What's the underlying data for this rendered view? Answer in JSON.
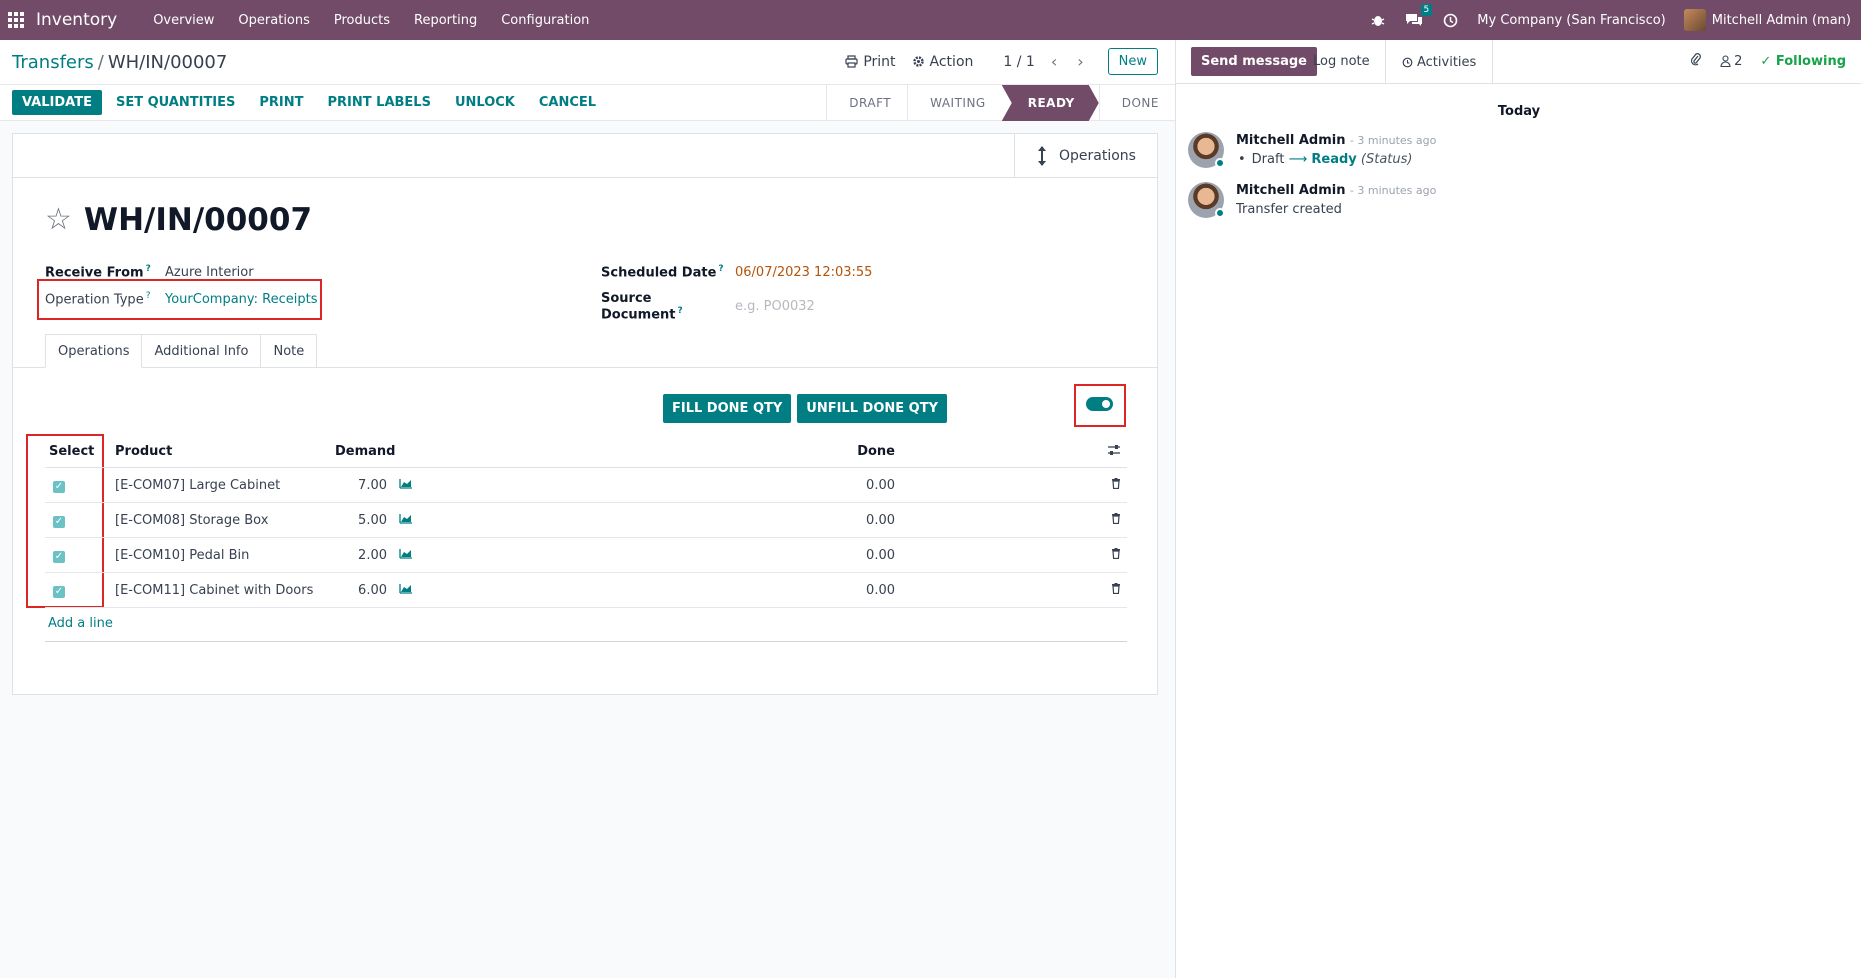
{
  "navbar": {
    "app_title": "Inventory",
    "menu": [
      "Overview",
      "Operations",
      "Products",
      "Reporting",
      "Configuration"
    ],
    "messages_count": "5",
    "company": "My Company (San Francisco)",
    "user": "Mitchell Admin (man)"
  },
  "control": {
    "breadcrumb_parent": "Transfers",
    "breadcrumb_sep": "/",
    "breadcrumb_current": "WH/IN/00007",
    "print_label": "Print",
    "action_label": "Action",
    "pager": "1 / 1",
    "new_label": "New"
  },
  "statusbar": {
    "buttons": [
      "VALIDATE",
      "SET QUANTITIES",
      "PRINT",
      "PRINT LABELS",
      "UNLOCK",
      "CANCEL"
    ],
    "stages": [
      "DRAFT",
      "WAITING",
      "READY",
      "DONE"
    ],
    "active_stage": "READY"
  },
  "form": {
    "smart_button": "Operations",
    "name": "WH/IN/00007",
    "receive_from_label": "Receive From",
    "receive_from_value": "Azure Interior",
    "operation_type_label": "Operation Type",
    "operation_type_value": "YourCompany: Receipts",
    "scheduled_date_label": "Scheduled Date",
    "scheduled_date_value": "06/07/2023 12:03:55",
    "source_document_label": "Source Document",
    "source_document_placeholder": "e.g. PO0032",
    "help_mark": "?",
    "tabs": [
      "Operations",
      "Additional Info",
      "Note"
    ],
    "fill_done": "FILL DONE QTY",
    "unfill_done": "UNFILL DONE QTY",
    "table": {
      "headers": {
        "select": "Select",
        "product": "Product",
        "demand": "Demand",
        "done": "Done"
      },
      "rows": [
        {
          "product": "[E-COM07] Large Cabinet",
          "demand": "7.00",
          "done": "0.00"
        },
        {
          "product": "[E-COM08] Storage Box",
          "demand": "5.00",
          "done": "0.00"
        },
        {
          "product": "[E-COM10] Pedal Bin",
          "demand": "2.00",
          "done": "0.00"
        },
        {
          "product": "[E-COM11] Cabinet with Doors",
          "demand": "6.00",
          "done": "0.00"
        }
      ],
      "add_line": "Add a line"
    }
  },
  "chatter": {
    "send_message": "Send message",
    "log_note": "Log note",
    "activities": "Activities",
    "followers_count": "2",
    "following": "Following",
    "today": "Today",
    "messages": [
      {
        "author": "Mitchell Admin",
        "time": "- 3 minutes ago",
        "from": "Draft",
        "to": "Ready",
        "field": "(Status)"
      },
      {
        "author": "Mitchell Admin",
        "time": "- 3 minutes ago",
        "body": "Transfer created"
      }
    ]
  },
  "colors": {
    "brand": "#714b67",
    "accent": "#017e84",
    "annotation": "#dc2626"
  }
}
